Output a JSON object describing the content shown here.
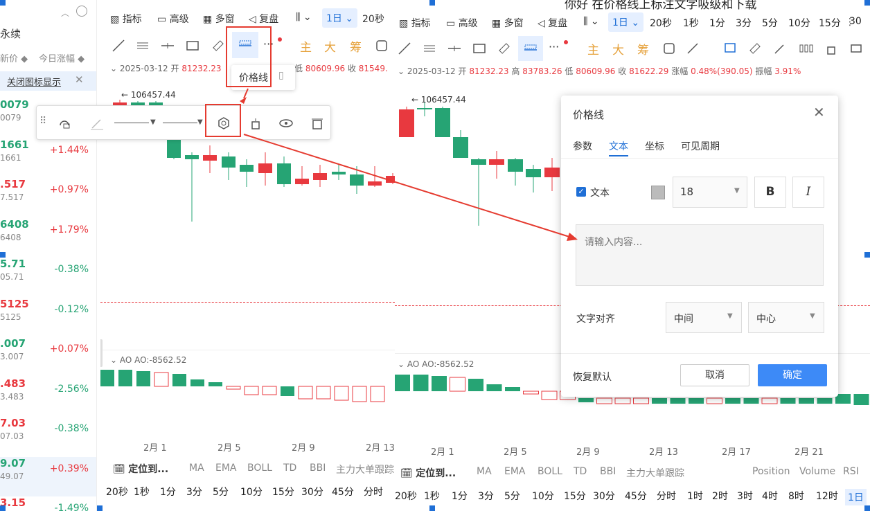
{
  "left_panel": {
    "title": "永续",
    "col_price": "新价 ◆",
    "col_change": "今日涨幅 ◆",
    "banner": "关闭图标显示",
    "rows": [
      {
        "price": "0079",
        "sub": "0079",
        "change": "",
        "dir": "dn"
      },
      {
        "price": "1661",
        "sub": "1661",
        "change": "+1.44%",
        "dir": "dn"
      },
      {
        "price": ".517",
        "sub": "7.517",
        "change": "+0.97%",
        "dir": "up"
      },
      {
        "price": "6408",
        "sub": "6408",
        "change": "+1.79%",
        "dir": "dn"
      },
      {
        "price": "5.71",
        "sub": "05.71",
        "change": "-0.38%",
        "dir": "dn"
      },
      {
        "price": "5125",
        "sub": "5125",
        "change": "-0.12%",
        "dir": "up"
      },
      {
        "price": ".007",
        "sub": "3.007",
        "change": "+0.07%",
        "dir": "dn"
      },
      {
        "price": ".483",
        "sub": "3.483",
        "change": "-2.56%",
        "dir": "up"
      },
      {
        "price": "7.03",
        "sub": "07.03",
        "change": "-0.38%",
        "dir": "up"
      },
      {
        "price": "9.07",
        "sub": "49.07",
        "change": "+0.39%",
        "dir": "dn"
      },
      {
        "price": "3.15",
        "sub": "",
        "change": "-1.49%",
        "dir": "up"
      }
    ]
  },
  "chart1": {
    "toolbar": [
      "指标",
      "高级",
      "多窗",
      "复盘"
    ],
    "period": "1日",
    "period2": "20秒",
    "icon_labels": [
      "主",
      "大",
      "筹"
    ],
    "ohlc_date": "2025-03-12",
    "ohlc_open_label": "开",
    "ohlc_open": "81232.23",
    "ohlc_low_label": "低",
    "ohlc_low": "80609.96",
    "ohlc_close_label": "收",
    "ohlc_close": "81549.",
    "high_marker": "← 106457.44",
    "ao_label": "AO  AO:-8562.52",
    "dates": [
      "2月 1",
      "2月 5",
      "2月 9",
      "2月 13"
    ],
    "bottom_left": "定位到...",
    "bottom_inds": [
      "MA",
      "EMA",
      "BOLL",
      "TD",
      "BBI",
      "主力大单跟踪"
    ],
    "periods": [
      "20秒",
      "1秒",
      "1分",
      "3分",
      "5分",
      "10分",
      "15分",
      "30分",
      "45分",
      "分时"
    ]
  },
  "tooltip": {
    "label": "价格线"
  },
  "chart2": {
    "toolbar": [
      "指标",
      "高级",
      "多窗",
      "复盘"
    ],
    "period": "1日",
    "periods_top": [
      "20秒",
      "1秒",
      "1分",
      "3分",
      "5分",
      "10分",
      "15分",
      "30"
    ],
    "icon_labels": [
      "主",
      "大",
      "筹"
    ],
    "ohlc": {
      "date": "2025-03-12",
      "open_label": "开",
      "open": "81232.23",
      "high_label": "高",
      "high": "83783.26",
      "low_label": "低",
      "low": "80609.96",
      "close_label": "收",
      "close": "81622.29",
      "chg_label": "涨幅",
      "chg": "0.48%(390.05)",
      "amp_label": "振幅",
      "amp": "3.91%"
    },
    "high_marker": "← 106457.44",
    "ao_label": "AO  AO:-8562.52",
    "dates": [
      "2月 1",
      "2月 5",
      "2月 9",
      "2月 13",
      "2月 17",
      "2月 21"
    ],
    "bottom_left": "定位到...",
    "bottom_inds": [
      "MA",
      "EMA",
      "BOLL",
      "TD",
      "BBI",
      "主力大单跟踪"
    ],
    "bottom_right": [
      "Position",
      "Volume",
      "RSI"
    ],
    "periods": [
      "20秒",
      "1秒",
      "1分",
      "3分",
      "5分",
      "10分",
      "15分",
      "30分",
      "45分",
      "分时",
      "1时",
      "2时",
      "3时",
      "4时",
      "8时",
      "12时",
      "1日"
    ],
    "top_text": "你好    在价格线上标注文字吸级和下载"
  },
  "dialog": {
    "title": "价格线",
    "tabs": [
      "参数",
      "文本",
      "坐标",
      "可见周期"
    ],
    "active_tab": "文本",
    "text_checkbox_label": "文本",
    "font_size": "18",
    "bold": "B",
    "italic": "I",
    "placeholder": "请输入内容...",
    "align_label": "文字对齐",
    "align_h": "中间",
    "align_v": "中心",
    "reset": "恢复默认",
    "cancel": "取消",
    "confirm": "确定"
  },
  "colors": {
    "up": "#e8393f",
    "down": "#26a474",
    "accent": "#1f6fd6",
    "annot": "#e53b30"
  }
}
